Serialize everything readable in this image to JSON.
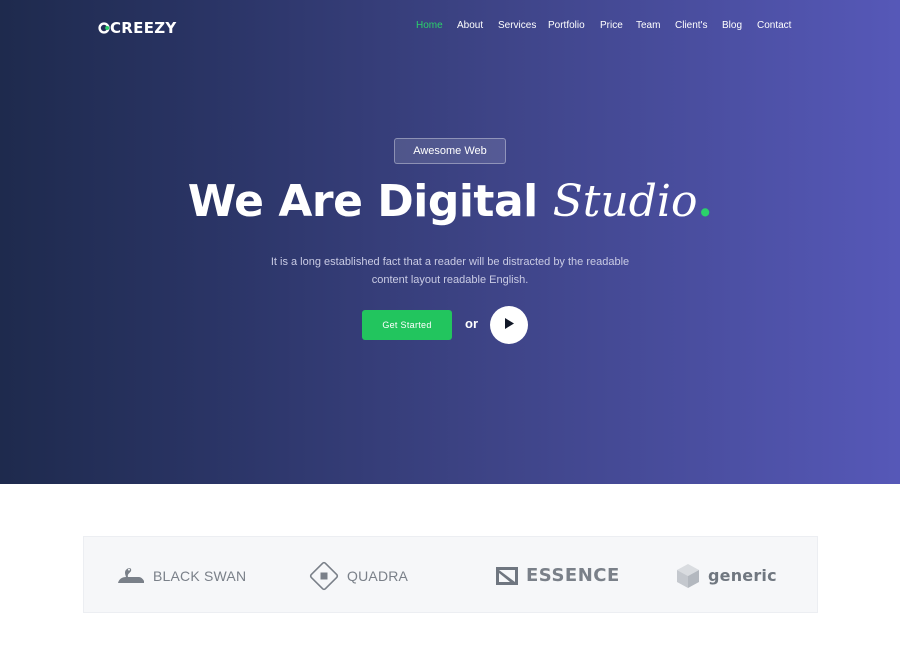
{
  "brand": {
    "name": "CREEZY",
    "logo_icon": "c-ring-logo-icon"
  },
  "nav": {
    "items": [
      {
        "label": "Home",
        "active": true
      },
      {
        "label": "About",
        "active": false
      },
      {
        "label": "Services",
        "active": false
      },
      {
        "label": "Portfolio",
        "active": false
      },
      {
        "label": "Price",
        "active": false
      },
      {
        "label": "Team",
        "active": false
      },
      {
        "label": "Client's",
        "active": false
      },
      {
        "label": "Blog",
        "active": false
      },
      {
        "label": "Contact",
        "active": false
      }
    ]
  },
  "hero": {
    "badge": "Awesome Web",
    "headline_main": "We Are Digital ",
    "headline_script": "Studio",
    "headline_dot": ".",
    "lead_line1": "It is a long established fact that a reader will be distracted by the readable",
    "lead_line2": "content layout readable English.",
    "cta_label": "Get Started",
    "or_text": "or",
    "play_icon": "play-icon"
  },
  "clients": [
    {
      "name": "BLACK SWAN",
      "icon": "swan-icon"
    },
    {
      "name": "QUADRA",
      "icon": "diamond-square-icon"
    },
    {
      "name": "ESSENCE",
      "icon": "flag-square-icon"
    },
    {
      "name": "generic",
      "icon": "cube-icon"
    }
  ],
  "colors": {
    "accent": "#22c55e",
    "hero_gradient_start": "#1e2a4d",
    "hero_gradient_end": "#5658b8",
    "client_gray": "#7a8089"
  }
}
